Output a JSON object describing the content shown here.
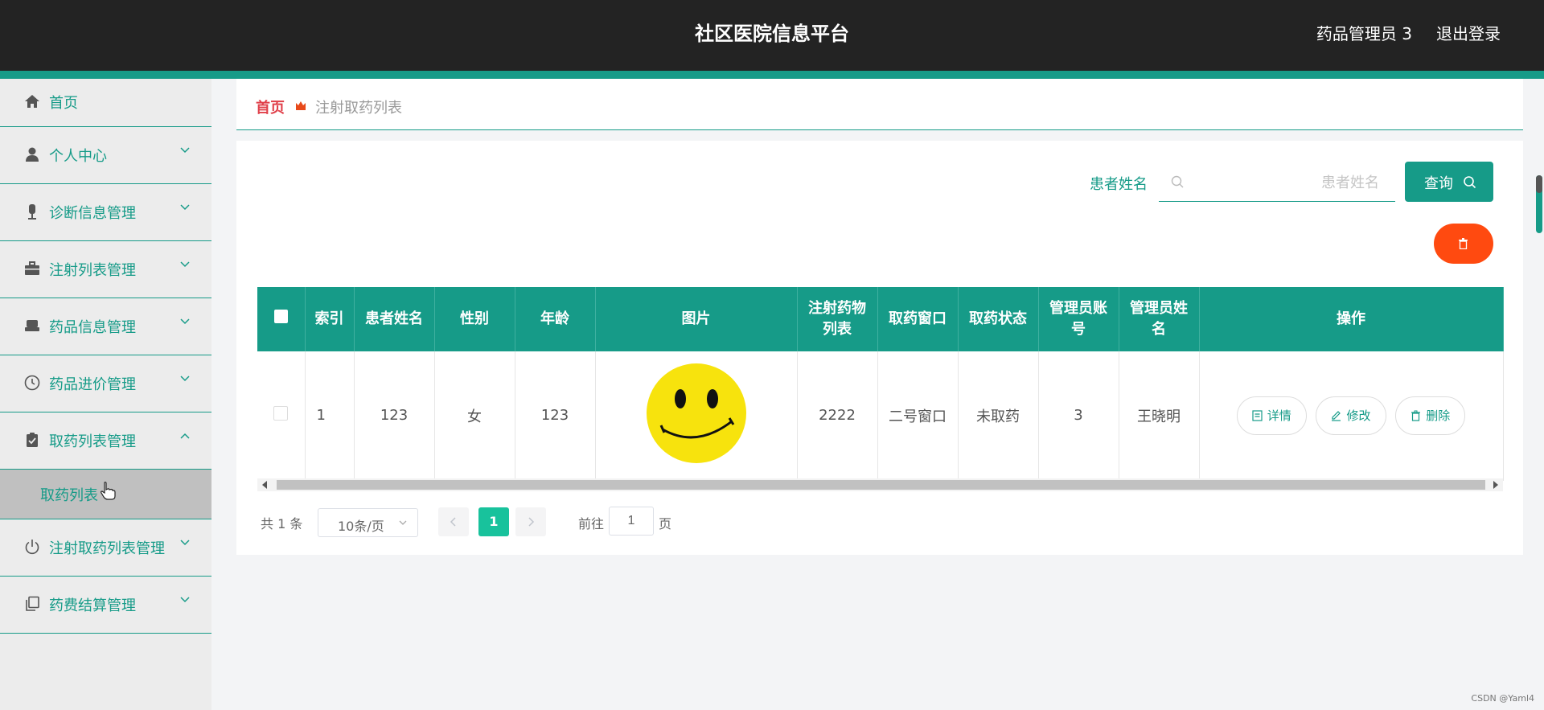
{
  "header": {
    "title": "社区医院信息平台",
    "user": "药品管理员 3",
    "logout": "退出登录"
  },
  "sidebar": {
    "items": [
      {
        "label": "首页",
        "icon": "home-icon"
      },
      {
        "label": "个人中心",
        "icon": "user-icon"
      },
      {
        "label": "诊断信息管理",
        "icon": "microphone-icon"
      },
      {
        "label": "注射列表管理",
        "icon": "briefcase-icon"
      },
      {
        "label": "药品信息管理",
        "icon": "printer-icon"
      },
      {
        "label": "药品进价管理",
        "icon": "clock-icon"
      },
      {
        "label": "取药列表管理",
        "icon": "clipboard-icon"
      },
      {
        "label": "注射取药列表管理",
        "icon": "power-icon"
      },
      {
        "label": "药费结算管理",
        "icon": "copy-icon"
      }
    ],
    "submenu": {
      "label": "取药列表"
    }
  },
  "breadcrumb": {
    "home": "首页",
    "current": "注射取药列表"
  },
  "search": {
    "label": "患者姓名",
    "placeholder": "患者姓名",
    "button": "查询"
  },
  "table": {
    "headers": [
      "索引",
      "患者姓名",
      "性别",
      "年龄",
      "图片",
      "注射药物列表",
      "取药窗口",
      "取药状态",
      "管理员账号",
      "管理员姓名",
      "操作"
    ],
    "rows": [
      {
        "index": "1",
        "name": "123",
        "gender": "女",
        "age": "123",
        "image": "smiley-face",
        "drugs": "2222",
        "window": "二号窗口",
        "status": "未取药",
        "admin_account": "3",
        "admin_name": "王晓明"
      }
    ],
    "actions": {
      "detail": "详情",
      "edit": "修改",
      "delete": "删除"
    }
  },
  "pagination": {
    "total": "共 1 条",
    "page_size": "10条/页",
    "current_page": "1",
    "goto_label": "前往",
    "goto_value": "1",
    "goto_suffix": "页"
  },
  "colors": {
    "accent": "#169b88",
    "header_bg": "#232323",
    "danger": "#ff4a10",
    "crumb_home": "#e0404a",
    "page_active": "#18c29c"
  },
  "watermark": "CSDN @Yaml4"
}
